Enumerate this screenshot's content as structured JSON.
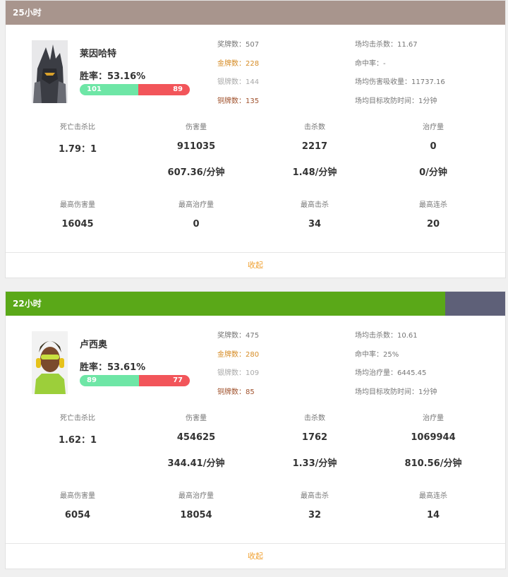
{
  "cards": [
    {
      "header": "25小时",
      "header_color": "#a8958d",
      "hero": "莱因哈特",
      "winrate": "胜率：53.16%",
      "wins": "101",
      "losses": "89",
      "win_fraction": 0.532,
      "medals": {
        "total": "奖牌数：507",
        "gold": "金牌数：228",
        "silver": "银牌数：144",
        "bronze": "铜牌数：135"
      },
      "avgs": {
        "kills": "场均击杀数：11.67",
        "accuracy": "命中率：-",
        "third": "场均伤害吸收量：11737.16",
        "objective": "场均目标攻防时间：1分钟"
      },
      "stats": {
        "kd_label": "死亡击杀比",
        "kd": "1.79：1",
        "dmg_label": "伤害量",
        "dmg": "911035",
        "dmg_rate": "607.36/分钟",
        "kills_label": "击杀数",
        "kills": "2217",
        "kills_rate": "1.48/分钟",
        "heal_label": "治疗量",
        "heal": "0",
        "heal_rate": "0/分钟",
        "max_dmg_label": "最高伤害量",
        "max_dmg": "16045",
        "max_heal_label": "最高治疗量",
        "max_heal": "0",
        "max_kills_label": "最高击杀",
        "max_kills": "34",
        "max_streak_label": "最高连杀",
        "max_streak": "20"
      },
      "footer": "收起"
    },
    {
      "header": "22小时",
      "header_color": "#5aa818",
      "header_remainder_color": "#5e6078",
      "header_fraction": 0.88,
      "hero": "卢西奥",
      "winrate": "胜率：53.61%",
      "wins": "89",
      "losses": "77",
      "win_fraction": 0.536,
      "medals": {
        "total": "奖牌数：475",
        "gold": "金牌数：280",
        "silver": "银牌数：109",
        "bronze": "铜牌数：85"
      },
      "avgs": {
        "kills": "场均击杀数：10.61",
        "accuracy": "命中率：25%",
        "third": "场均治疗量：6445.45",
        "objective": "场均目标攻防时间：1分钟"
      },
      "stats": {
        "kd_label": "死亡击杀比",
        "kd": "1.62：1",
        "dmg_label": "伤害量",
        "dmg": "454625",
        "dmg_rate": "344.41/分钟",
        "kills_label": "击杀数",
        "kills": "1762",
        "kills_rate": "1.33/分钟",
        "heal_label": "治疗量",
        "heal": "1069944",
        "heal_rate": "810.56/分钟",
        "max_dmg_label": "最高伤害量",
        "max_dmg": "6054",
        "max_heal_label": "最高治疗量",
        "max_heal": "18054",
        "max_kills_label": "最高击杀",
        "max_kills": "32",
        "max_streak_label": "最高连杀",
        "max_streak": "14"
      },
      "footer": "收起"
    }
  ]
}
